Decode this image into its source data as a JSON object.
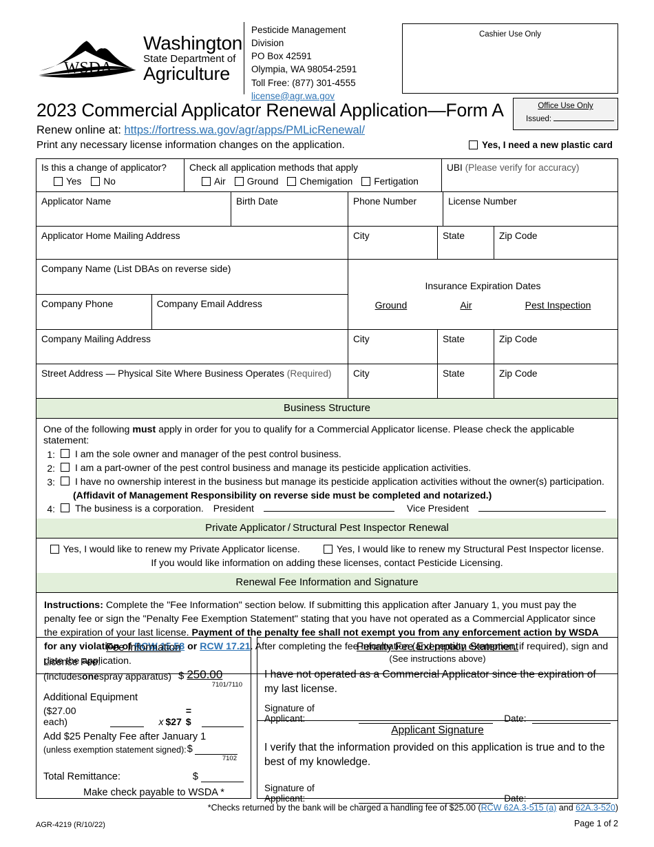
{
  "agency": {
    "logo_line1": "Washington",
    "logo_line2": "State Department of",
    "logo_line3": "Agriculture",
    "logo_mark_text": "WSDA"
  },
  "contact": {
    "division": "Pesticide Management Division",
    "po_box": "PO Box 42591",
    "city_state_zip": "Olympia, WA  98054-2591",
    "toll_free": "Toll Free: (877) 301-4555",
    "email": "license@agr.wa.gov"
  },
  "cashier_box": {
    "label": "Cashier Use Only"
  },
  "title": "2023 Commercial Applicator Renewal Application—Form A",
  "renew_prefix": "Renew online at: ",
  "renew_url": "https://fortress.wa.gov/agr/apps/PMLicRenewal/",
  "print_line": "Print any necessary license information changes on the application.",
  "office_box": {
    "title": "Office Use Only",
    "issued_label": "Issued:"
  },
  "plastic_card": {
    "label": "Yes, I need a new plastic card"
  },
  "change_applicator": {
    "question": "Is this a change of applicator?",
    "yes": "Yes",
    "no": "No"
  },
  "methods": {
    "heading": "Check all application methods that apply",
    "options": [
      "Air",
      "Ground",
      "Chemigation",
      "Fertigation"
    ]
  },
  "ubi": {
    "label": "UBI ",
    "sub": "(Please verify for accuracy)"
  },
  "applicant_row": {
    "applicator_name": "Applicator Name",
    "birth_date": "Birth Date",
    "phone_number": "Phone Number",
    "license_number": "License Number"
  },
  "home_address_row": {
    "address": "Applicator Home Mailing Address",
    "city": "City",
    "state": "State",
    "zip": "Zip Code"
  },
  "company": {
    "name_label": "Company Name ",
    "name_sub": "(List DBAs on reverse side)",
    "phone": "Company Phone",
    "email": "Company Email Address"
  },
  "insurance": {
    "heading": "Insurance Expiration Dates",
    "columns": [
      "Ground",
      "Air",
      "Pest Inspection"
    ]
  },
  "company_mailing_row": {
    "address": "Company Mailing Address",
    "city": "City",
    "state": "State",
    "zip": "Zip Code"
  },
  "street_row": {
    "address": "Street Address — Physical Site Where Business Operates ",
    "address_sub": "(Required)",
    "city": "City",
    "state": "State",
    "zip": "Zip Code"
  },
  "business_structure": {
    "heading": "Business Structure",
    "intro_a": "One of the following ",
    "intro_b": "must",
    "intro_c": " apply in order for you to qualify for a Commercial Applicator license. Please check the applicable statement:",
    "items": [
      {
        "num": "1:",
        "text": "I am the sole owner and manager of the pest control business."
      },
      {
        "num": "2:",
        "text": "I am a part-owner of the pest control business and manage its pesticide application activities."
      },
      {
        "num": "3:",
        "text": "I have no ownership interest in the business but manage its pesticide application activities without the owner(s) participation."
      },
      {
        "num": "4:",
        "text": "The business is a corporation."
      }
    ],
    "affidavit_note": "(Affidavit of Management Responsibility on reverse side must be completed and notarized.)",
    "president_label": "President",
    "vice_president_label": "Vice President"
  },
  "private_applicator": {
    "heading": "Private Applicator / Structural Pest Inspector Renewal",
    "option1": "Yes, I would like to renew my Private Applicator license.",
    "option2": "Yes, I would like to renew my Structural Pest Inspector license.",
    "note": "If you would like information on adding these licenses, contact Pesticide Licensing."
  },
  "renewal_fee": {
    "heading": "Renewal Fee Information and Signature",
    "instructions_label": "Instructions:",
    "instructions_1": " Complete the \"Fee Information\" section below.  If submitting this application after January 1, you must pay the penalty fee or sign the \"Penalty Fee Exemption Statement\" stating that you have not operated as a Commercial Applicator since the expiration of your last license.  ",
    "instructions_bold": "Payment of the penalty fee shall not exempt you from any enforcement action by WSDA for any violation of ",
    "rcw1": "RCW 15.58",
    "rcw_or": " or ",
    "rcw2": "RCW 17.21",
    "instructions_2": ".  After completing the fee information (and penalty exemption, if required), sign and date the application."
  },
  "fee_information": {
    "title": "Fee Information",
    "license_fee_label": "License Fee:",
    "includes_a": "(includes ",
    "includes_bold": "one",
    "includes_b": " spray apparatus)",
    "dollar": "$",
    "license_fee_amount": "250.00",
    "license_fee_code": "7101/7110",
    "additional_equipment": "Additional Equipment",
    "each_cost": "($27.00 each)",
    "times": "x",
    "per_unit": "$27",
    "equals": "= $",
    "penalty_label": "Add $25 Penalty Fee after January 1",
    "penalty_sub": "(unless exemption statement signed):",
    "penalty_code": "7102",
    "total_label": "Total Remittance:",
    "make_check": "Make check payable to WSDA *"
  },
  "penalty_exemption": {
    "title": "Penalty Fee Exemption Statement",
    "subtitle": "(See instructions above)",
    "body": "I have not operated as a Commercial Applicator since the expiration of my last license.",
    "signature_label": "Signature of Applicant:",
    "date_label": "Date:"
  },
  "applicant_signature": {
    "title": "Applicant Signature",
    "body": "I verify that the information provided on this application is true and to the best of my knowledge.",
    "signature_label": "Signature of Applicant:",
    "date_label": "Date:"
  },
  "footer": {
    "checks_note_a": "*Checks returned by the bank will be charged a handling fee of $25.00 (",
    "checks_link1": "RCW 62A.3-515 (a)",
    "checks_note_b": " and ",
    "checks_link2": "62A.3-520",
    "checks_note_c": ")",
    "form_number": "AGR-4219 (R/10/22)",
    "page": "Page 1 of 2"
  },
  "colors": {
    "section_header_green": "#e2efda",
    "link_blue": "#2e74b5",
    "office_box_gray": "#f2f2f2"
  }
}
